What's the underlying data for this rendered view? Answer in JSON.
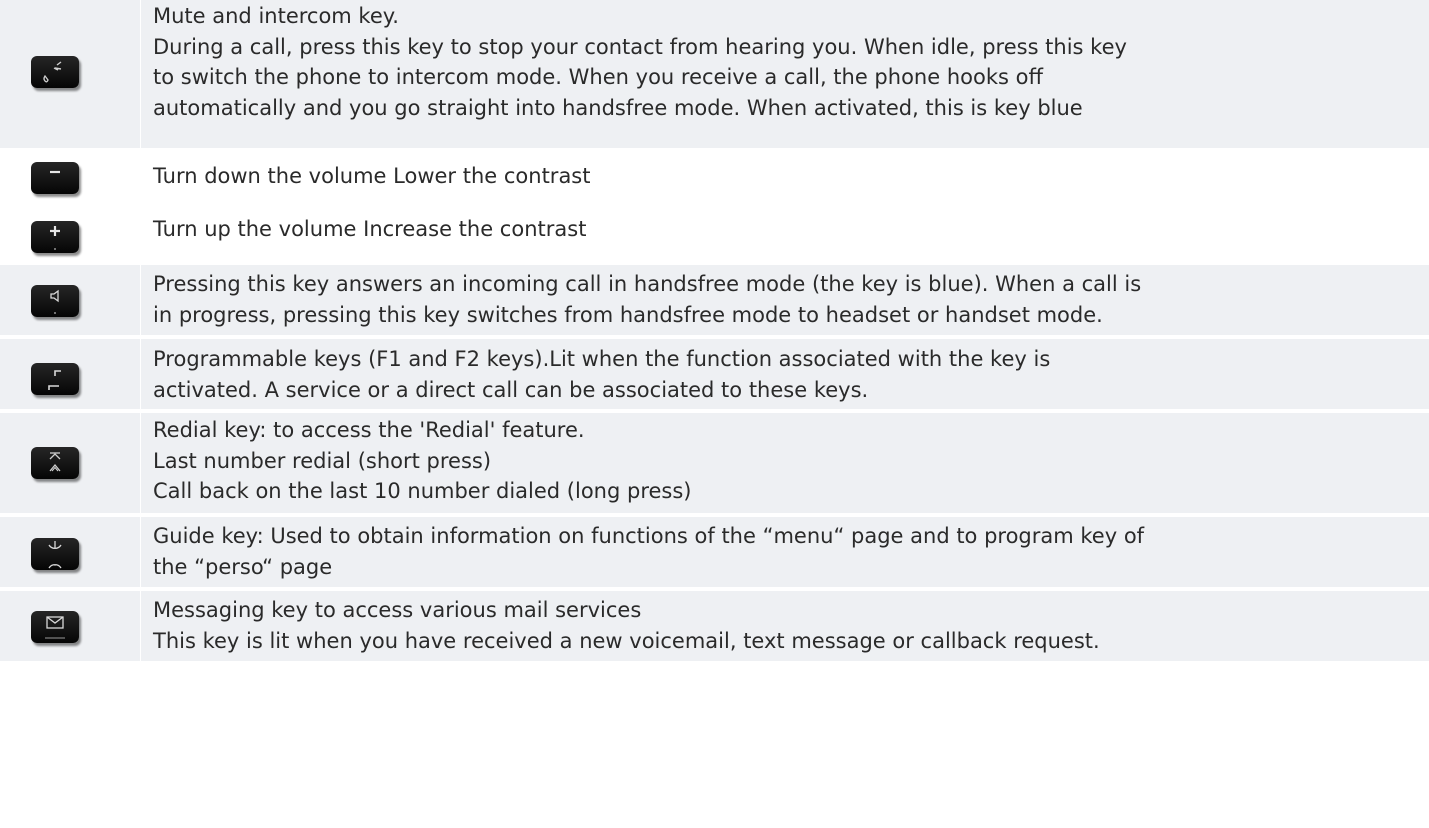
{
  "rows": [
    {
      "icon": "mute-intercom-key-icon",
      "lines": [
        "Mute and intercom key.",
        "During a call, press this key to stop your contact from hearing you. When idle, press this key",
        "to switch the phone to intercom mode. When you receive a call, the phone hooks off",
        "automatically and you go straight into handsfree mode. When activated, this is key blue"
      ]
    },
    {
      "icon": "volume-down-key-icon",
      "lines": [
        "Turn down the volume Lower the contrast"
      ]
    },
    {
      "icon": "volume-up-key-icon",
      "lines": [
        "Turn up the volume Increase the contrast"
      ]
    },
    {
      "icon": "handsfree-key-icon",
      "lines": [
        "Pressing this key answers an incoming call in handsfree mode (the key is blue). When a call is",
        "in progress, pressing this key switches from handsfree mode to headset or handset mode."
      ]
    },
    {
      "icon": "programmable-key-icon",
      "lines": [
        "Programmable keys (F1 and F2 keys).Lit when the function associated with the key is",
        "activated. A service or a direct call can be associated to these keys."
      ]
    },
    {
      "icon": "redial-key-icon",
      "lines": [
        "Redial key: to access the 'Redial' feature.",
        "Last number redial (short press)",
        "Call back on the last 10 number dialed (long press)"
      ]
    },
    {
      "icon": "guide-key-icon",
      "lines": [
        "Guide key: Used to obtain information on functions of the “menu“ page and to program key of",
        "the “perso“ page"
      ]
    },
    {
      "icon": "messaging-key-icon",
      "lines": [
        "Messaging key to access various mail services",
        "This key is lit when you have received a new voicemail, text message or callback request."
      ]
    }
  ],
  "colors": {
    "row_background": "#eef0f3",
    "text": "#2a2a2a",
    "key": "#0a0a0a"
  }
}
